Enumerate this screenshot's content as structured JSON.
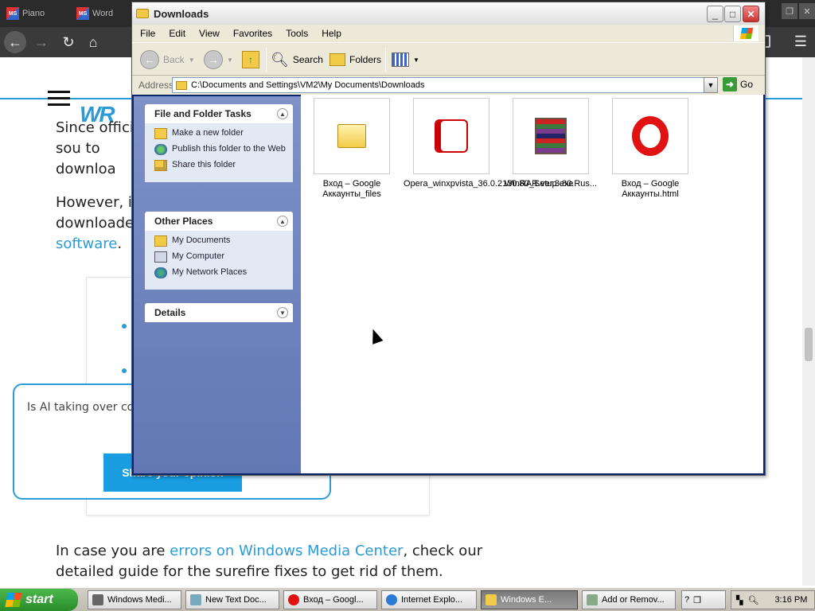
{
  "browser": {
    "tabs": [
      {
        "label": "Piano",
        "icon": "ms-office-icon"
      },
      {
        "label": "Word",
        "icon": "ms-office-icon"
      }
    ],
    "tab_icon_text": "MS",
    "nav_back": "←",
    "nav_forward": "→",
    "nav_reload": "↻",
    "nav_home": "⌂",
    "menu_glyph": "☰",
    "win_controls": [
      "❐",
      "✕"
    ]
  },
  "webpage": {
    "logo": "WR",
    "p1": "Since official sou to downloa",
    "p2_a": "However, if downloade",
    "p2_link": "software",
    "p2_end": ".",
    "p3_a": "In case you are ",
    "p3_link": "errors on Windows Media Center",
    "p3_b": ", check our detailed guide for the surefire fixes to get rid of them.",
    "survey_text": "Is AI taking over cor answering a couple",
    "survey_button": "Share your opinion"
  },
  "explorer": {
    "title": "Downloads",
    "menu": [
      "File",
      "Edit",
      "View",
      "Favorites",
      "Tools",
      "Help"
    ],
    "toolbar": {
      "back": "Back",
      "search": "Search",
      "folders": "Folders"
    },
    "address_label": "Address",
    "address_value": "C:\\Documents and Settings\\VM2\\My Documents\\Downloads",
    "go_label": "Go",
    "tasks": {
      "title": "File and Folder Tasks",
      "items": [
        "Make a new folder",
        "Publish this folder to the Web",
        "Share this folder"
      ]
    },
    "places": {
      "title": "Other Places",
      "items": [
        "My Documents",
        "My Computer",
        "My Network Places"
      ]
    },
    "details": {
      "title": "Details"
    },
    "files": [
      {
        "name": "Вход – Google Аккаунты_files",
        "icon": "folder-icon"
      },
      {
        "name": "Opera_winxpvista_36.0.2130.80_Setup.exe",
        "icon": "opera-setup-icon"
      },
      {
        "name": "WinRAR.ver.3.80.Rus...",
        "icon": "winrar-icon"
      },
      {
        "name": "Вход – Google Аккаунты.html",
        "icon": "opera-icon"
      }
    ]
  },
  "taskbar": {
    "start": "start",
    "buttons": [
      {
        "label": "Windows Medi...",
        "icon": "windows-media-icon"
      },
      {
        "label": "New Text Doc...",
        "icon": "notepad-icon"
      },
      {
        "label": "Вход – Googl...",
        "icon": "opera-icon"
      },
      {
        "label": "Internet Explo...",
        "icon": "ie-icon"
      },
      {
        "label": "Windows E...",
        "icon": "folder-icon"
      },
      {
        "label": "Add or Remov...",
        "icon": "add-remove-icon"
      }
    ],
    "clock": "3:16 PM"
  },
  "colors": {
    "accent": "#2a9bd6",
    "xp_green": "#2a8c2a",
    "opera_red": "#e01212"
  }
}
